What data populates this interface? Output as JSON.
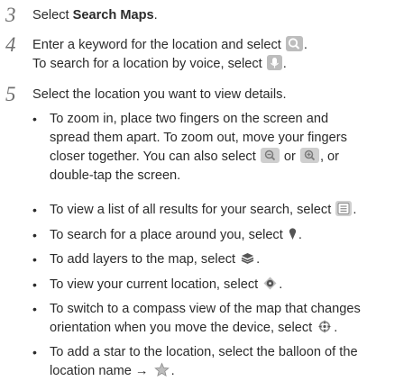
{
  "steps": [
    {
      "number": "3",
      "pre": "Select ",
      "bold": "Search Maps",
      "post": "."
    },
    {
      "number": "4",
      "line1": "Enter a keyword for the location and select ",
      "line1_end": ".",
      "line2": "To search for a location by voice, select ",
      "line2_end": "."
    },
    {
      "number": "5",
      "line1": "Select the location you want to view details."
    }
  ],
  "bullets": [
    {
      "lines": [
        "To zoom in, place two fingers on the screen and",
        "spread them apart. To zoom out, move your fingers",
        "closer together. You can also select "
      ],
      "mid": " or ",
      "tail": ", or",
      "last": "double-tap the screen."
    },
    {
      "text": "To view a list of all results for your search, select ",
      "end": "."
    },
    {
      "text": "To search for a place around you, select ",
      "end": "."
    },
    {
      "text": "To add layers to the map, select ",
      "end": "."
    },
    {
      "text": "To view your current location, select ",
      "end": "."
    },
    {
      "lines": [
        "To switch to a compass view of the map that changes",
        "orientation when you move the device, select "
      ],
      "end": "."
    },
    {
      "lines": [
        "To add a star to the location, select the balloon of the",
        "location name → "
      ],
      "end": "."
    }
  ],
  "bullet_char": "•",
  "icons": [
    "search-icon",
    "microphone-icon",
    "zoom-out-icon",
    "zoom-in-icon",
    "list-icon",
    "place-pin-icon",
    "layers-icon",
    "current-location-icon",
    "compass-icon",
    "star-icon"
  ],
  "colors": {
    "text": "#2b2b2b",
    "step_number": "#707070",
    "icon_bg": "#c8c8c8"
  }
}
